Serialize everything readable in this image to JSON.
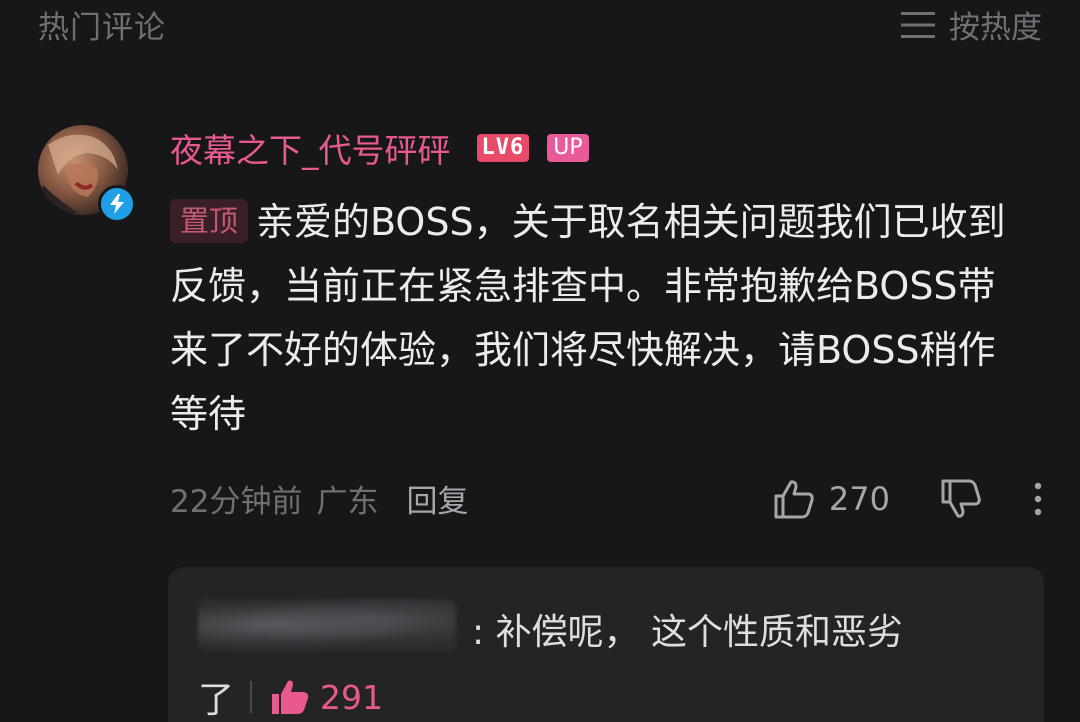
{
  "header": {
    "section_title": "热门评论",
    "sort_icon": "menu-lines-icon",
    "sort_label": "按热度"
  },
  "comment": {
    "avatar": "user-avatar",
    "verified_icon": "lightning-icon",
    "username": "夜幕之下_代号砰砰",
    "level_badge": "LV6",
    "up_badge": "UP",
    "pin_tag": "置顶",
    "text": "亲爱的BOSS，关于取名相关问题我们已收到反馈，当前正在紧急排查中。非常抱歉给BOSS带来了不好的体验，我们将尽快解决，请BOSS稍作等待",
    "time": "22分钟前",
    "location": "广东",
    "reply_label": "回复",
    "like_icon": "thumbs-up-icon",
    "like_count": "270",
    "dislike_icon": "thumbs-down-icon",
    "more_icon": "more-vertical-icon"
  },
  "reply_preview": {
    "text_line1": ": 补偿呢， 这个性质和恶劣",
    "text_line2": "了",
    "like_icon": "thumbs-up-icon",
    "like_count": "291"
  },
  "colors": {
    "background": "#17171a",
    "username": "#e85a8f",
    "accent_pink": "#e85a8f",
    "muted_text": "#6f6f74"
  }
}
